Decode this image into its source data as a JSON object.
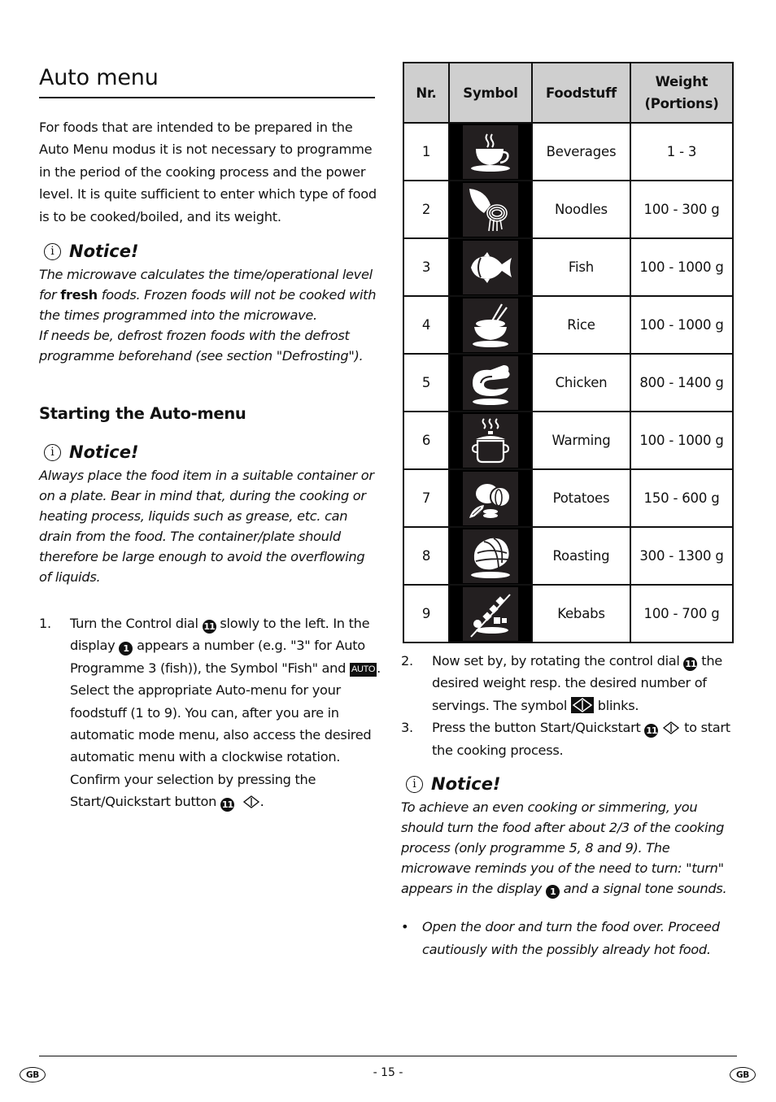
{
  "title": "Auto menu",
  "intro": "For foods that are intended to be prepared in the Auto Menu modus it is not necessary to programme in the period of the cooking process and the power level. It is quite sufficient to enter which type of food is to be cooked/boiled, and its weight.",
  "notice_label": "Notice!",
  "notice1": {
    "before": "The microwave calculates the time/operational level for ",
    "bold": "fresh",
    "after": " foods. Frozen foods will not be cooked with the times programmed into the microwave.",
    "line2": "If needs be, defrost frozen foods with the defrost programme beforehand (see section \"Defrosting\")."
  },
  "subheading": "Starting the Auto-menu",
  "notice2": "Always place the food item in a suitable container or on a plate. Bear in mind that, during the cooking or heating process, liquids such as grease, etc. can drain from the food. The container/plate should therefore be large enough to avoid the overflowing of liquids.",
  "step1": {
    "num": "1.",
    "a": "Turn the Control dial ",
    "ref11": "11",
    "b": " slowly to the left. In the display ",
    "ref1": "1",
    "c": " appears a number (e.g. \"3\" for Auto Programme 3 (fish)), the Symbol \"Fish\" and ",
    "auto_badge": "AUTO",
    "d": ". Select the appropriate Auto-menu for your foodstuff (1 to 9). You can, after you are in automatic mode menu, also access the desired automatic menu with a clockwise rotation. Confirm your selection by pressing the Start/Quickstart button ",
    "e": "."
  },
  "table": {
    "headers": {
      "nr": "Nr.",
      "symbol": "Symbol",
      "food": "Foodstuff",
      "weight_line1": "Weight",
      "weight_line2": "(Portions)"
    },
    "rows": [
      {
        "nr": "1",
        "icon": "beverage-cup-icon",
        "food": "Beverages",
        "weight": "1 - 3"
      },
      {
        "nr": "2",
        "icon": "noodles-icon",
        "food": "Noodles",
        "weight": "100 - 300 g"
      },
      {
        "nr": "3",
        "icon": "fish-icon",
        "food": "Fish",
        "weight": "100 - 1000 g"
      },
      {
        "nr": "4",
        "icon": "rice-bowl-icon",
        "food": "Rice",
        "weight": "100 - 1000 g"
      },
      {
        "nr": "5",
        "icon": "chicken-leg-icon",
        "food": "Chicken",
        "weight": "800 - 1400 g"
      },
      {
        "nr": "6",
        "icon": "warming-pot-icon",
        "food": "Warming",
        "weight": "100 - 1000 g"
      },
      {
        "nr": "7",
        "icon": "potatoes-icon",
        "food": "Potatoes",
        "weight": "150 - 600 g"
      },
      {
        "nr": "8",
        "icon": "roast-icon",
        "food": "Roasting",
        "weight": "300 - 1300 g"
      },
      {
        "nr": "9",
        "icon": "kebab-skewer-icon",
        "food": "Kebabs",
        "weight": "100 - 700 g"
      }
    ]
  },
  "step2": {
    "num": "2.",
    "a": "Now set by, by rotating the control dial ",
    "ref11": "11",
    "b": " the desired weight resp. the desired number of servings. The symbol ",
    "c": " blinks."
  },
  "step3": {
    "num": "3.",
    "a": "Press the button Start/Quickstart ",
    "ref11": "11",
    "b": " to start the cooking process."
  },
  "notice3": {
    "a": "To achieve an even cooking or simmering, you should turn the food after about 2/3 of the cooking process (only programme 5, 8 and 9). The microwave reminds you of the need to turn: \"turn\" appears in the display ",
    "ref1": "1",
    "b": " and a signal tone sounds."
  },
  "bullet": "Open the door and turn the food over. Proceed cautiously with the possibly already hot food.",
  "footer": {
    "country_left": "GB",
    "page": "- 15 -",
    "country_right": "GB"
  }
}
